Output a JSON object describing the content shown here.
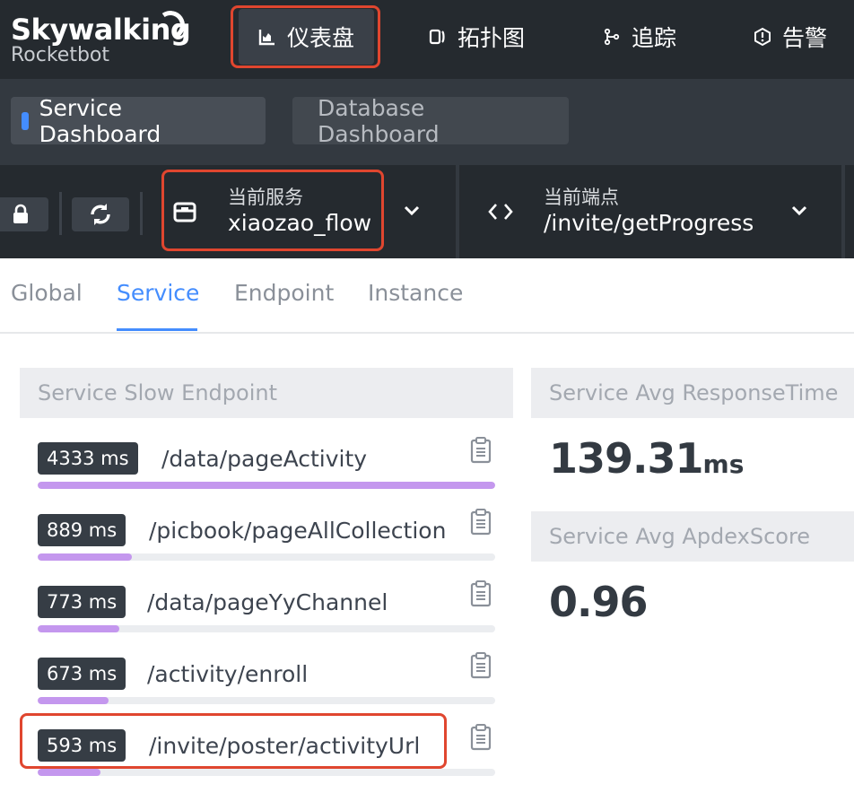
{
  "header": {
    "brand": "Skywalking",
    "subtitle": "Rocketbot",
    "nav": [
      {
        "label": "仪表盘",
        "icon": "chart-icon"
      },
      {
        "label": "拓扑图",
        "icon": "topology-icon"
      },
      {
        "label": "追踪",
        "icon": "trace-branch-icon"
      },
      {
        "label": "告警",
        "icon": "alarm-icon"
      }
    ]
  },
  "dashboards": {
    "tabs": [
      "Service Dashboard",
      "Database Dashboard"
    ],
    "active": "Service Dashboard"
  },
  "selectors": {
    "service": {
      "label": "当前服务",
      "value": "xiaozao_flow"
    },
    "endpoint": {
      "label": "当前端点",
      "value": "/invite/getProgress"
    }
  },
  "subtabs": {
    "items": [
      "Global",
      "Service",
      "Endpoint",
      "Instance"
    ],
    "active": "Service"
  },
  "slow_endpoint": {
    "title": "Service Slow Endpoint",
    "rows": [
      {
        "ms": "4333 ms",
        "name": "/data/pageActivity",
        "ratio": 1.0
      },
      {
        "ms": "889 ms",
        "name": "/picbook/pageAllCollection",
        "ratio": 0.205
      },
      {
        "ms": "773 ms",
        "name": "/data/pageYyChannel",
        "ratio": 0.178
      },
      {
        "ms": "673 ms",
        "name": "/activity/enroll",
        "ratio": 0.155
      },
      {
        "ms": "593 ms",
        "name": "/invite/poster/activityUrl",
        "ratio": 0.137
      }
    ]
  },
  "avg_response": {
    "title": "Service Avg ResponseTime",
    "value": "139.31",
    "unit": "ms"
  },
  "apdex": {
    "title": "Service Avg ApdexScore",
    "value": "0.96"
  },
  "colors": {
    "accent": "#448dfe",
    "highlight": "#e0462f",
    "bar": "#c497ee"
  }
}
